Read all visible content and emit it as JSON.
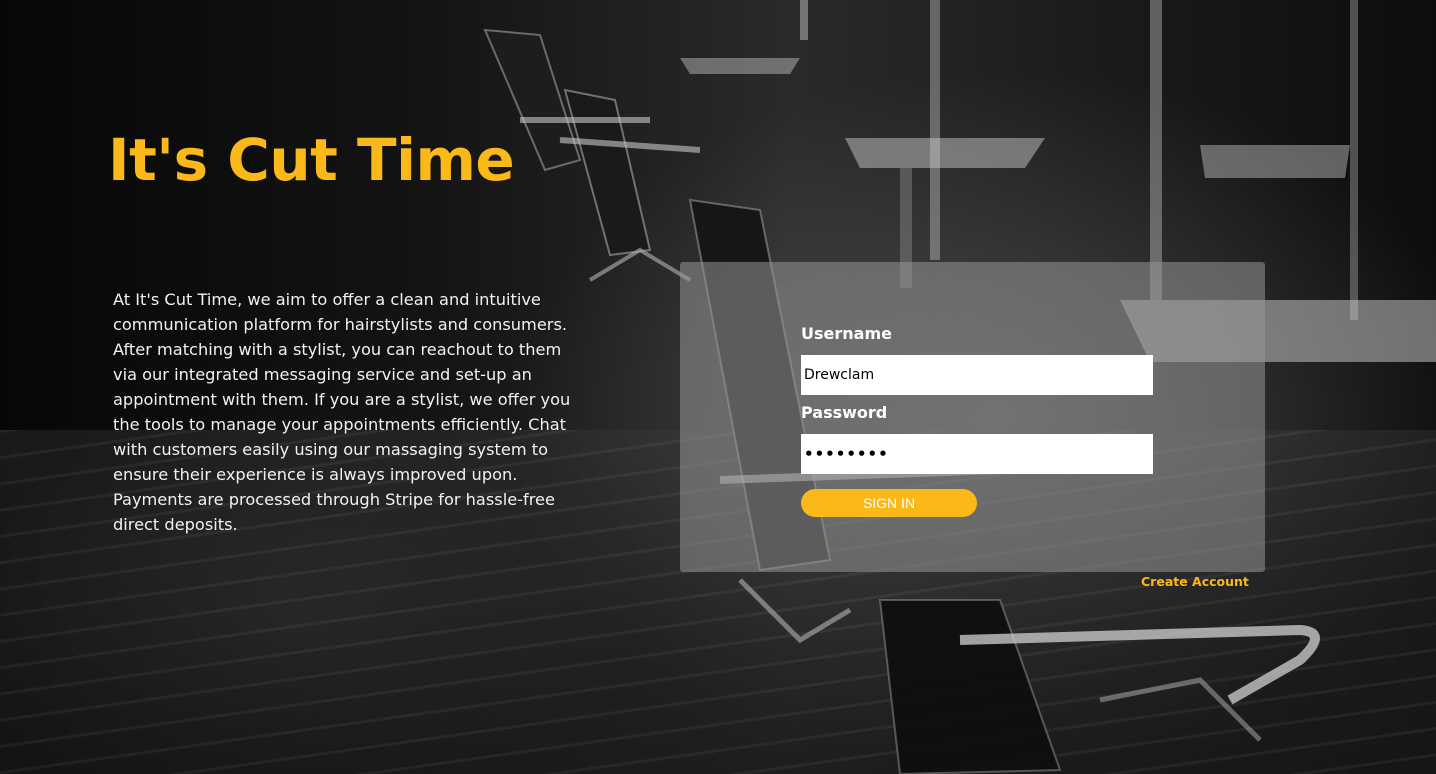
{
  "brand": {
    "title": "It's Cut Time",
    "accent_color": "#fbb919"
  },
  "about": {
    "text": "At It's Cut Time, we aim to offer a clean and intuitive communication platform for hairstylists and consumers. After matching with a stylist, you can reachout to them via our integrated messaging service and set-up an appointment with them. If you are a stylist, we offer you the tools to manage your appointments efficiently. Chat with customers easily using our massaging system to ensure their experience is always improved upon. Payments are processed through Stripe for hassle-free direct deposits."
  },
  "login": {
    "username_label": "Username",
    "username_value": "Drewclam",
    "password_label": "Password",
    "password_value": "••••••••",
    "signin_label": "SIGN IN",
    "create_account_label": "Create Account"
  },
  "background": {
    "description_icon": "salon-photo"
  }
}
